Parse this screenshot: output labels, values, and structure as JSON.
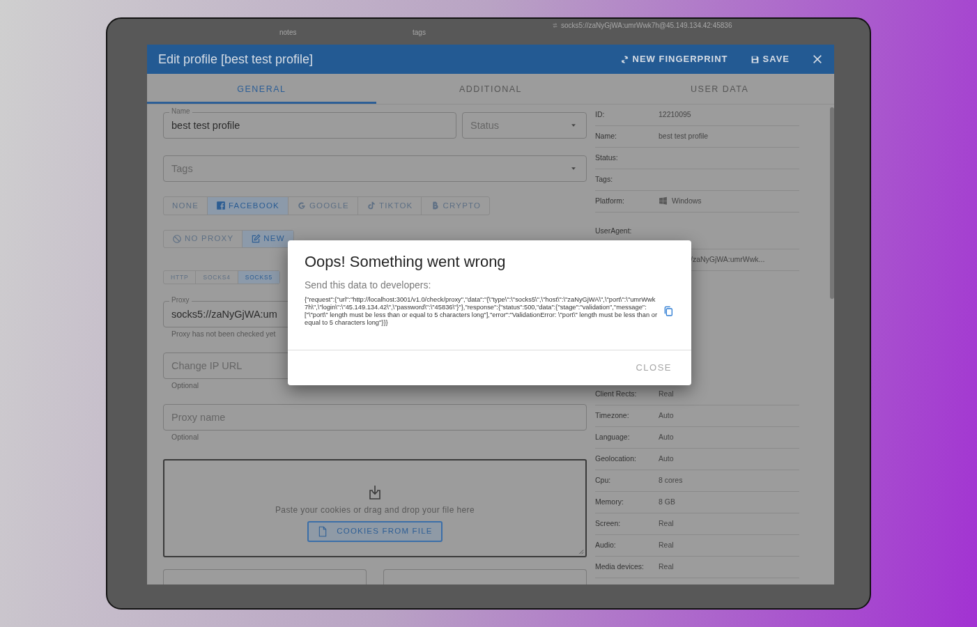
{
  "background_table": {
    "columns": [
      "notes",
      "tags"
    ],
    "proxy": "socks5://zaNyGjWA:umrWwk7h@45.149.134.42:45836"
  },
  "dialog": {
    "title": "Edit profile [best test profile]",
    "actions": [
      {
        "kind": "fingerprint",
        "label": "NEW FINGERPRINT"
      },
      {
        "kind": "save",
        "label": "SAVE"
      }
    ],
    "tabs": [
      {
        "label": "GENERAL",
        "selected": true
      },
      {
        "label": "ADDITIONAL",
        "selected": false
      },
      {
        "label": "USER DATA",
        "selected": false
      }
    ],
    "form": {
      "name_field": {
        "label": "Name",
        "value": "best test profile"
      },
      "status_field": {
        "placeholder": "Status"
      },
      "tags_field": {
        "placeholder": "Tags"
      },
      "platform_buttons": [
        {
          "kind": "none",
          "label": "NONE",
          "selected": false
        },
        {
          "kind": "facebook",
          "label": "FACEBOOK",
          "selected": true
        },
        {
          "kind": "google",
          "label": "GOOGLE",
          "selected": false
        },
        {
          "kind": "tiktok",
          "label": "TIKTOK",
          "selected": false
        },
        {
          "kind": "crypto",
          "label": "CRYPTO",
          "selected": false
        }
      ],
      "proxy_modes": [
        {
          "kind": "none",
          "label": "NO PROXY",
          "selected": false
        },
        {
          "kind": "new",
          "label": "NEW",
          "selected": true
        }
      ],
      "protocols": [
        {
          "label": "HTTP",
          "selected": false
        },
        {
          "label": "SOCKS4",
          "selected": false
        },
        {
          "label": "SOCKS5",
          "selected": true
        }
      ],
      "proxy_field": {
        "label": "Proxy",
        "value": "socks5://zaNyGjWA:um",
        "helper": "Proxy has not been checked yet"
      },
      "change_ip_field": {
        "placeholder": "Change IP URL",
        "helper": "Optional"
      },
      "proxy_name_field": {
        "placeholder": "Proxy name",
        "helper": "Optional"
      },
      "cookies": {
        "hint": "Paste your cookies or drag and drop your file here",
        "button": "COOKIES FROM FILE"
      }
    },
    "info_top": [
      {
        "label": "ID:",
        "value": "12210095"
      },
      {
        "label": "Name:",
        "value": "best test profile"
      },
      {
        "label": "Status:"
      },
      {
        "label": "Tags:"
      },
      {
        "label": "Platform:",
        "value": "Windows",
        "kind": "os"
      },
      {
        "label": "UserAgent:",
        "kind": "tall"
      },
      {
        "value": "/zaNyGjWA:umrWwk..."
      }
    ],
    "info_bottom": [
      {
        "label": "Client Rects:",
        "value": "Real"
      },
      {
        "label": "Timezone:",
        "value": "Auto"
      },
      {
        "label": "Language:",
        "value": "Auto"
      },
      {
        "label": "Geolocation:",
        "value": "Auto"
      },
      {
        "label": "Cpu:",
        "value": "8 cores"
      },
      {
        "label": "Memory:",
        "value": "8 GB"
      },
      {
        "label": "Screen:",
        "value": "Real"
      },
      {
        "label": "Audio:",
        "value": "Real"
      },
      {
        "label": "Media devices:",
        "value": "Real"
      }
    ]
  },
  "error_modal": {
    "title": "Oops! Something went wrong",
    "subtitle": "Send this data to developers:",
    "details": "{\"request\":{\"url\":\"http://localhost:3001/v1.0/check/proxy\",\"data\":\"{\\\"type\\\":\\\"socks5\\\",\\\"host\\\":\\\"zaNyGjWA\\\",\\\"port\\\":\\\"umrWwk7h\\\",\\\"login\\\":\\\"45.149.134.42\\\",\\\"password\\\":\\\"45836\\\"}\"},\"response\":{\"status\":500,\"data\":{\"stage\":\"validation\",\"message\":[\"\\\"port\\\" length must be less than or equal to 5 characters long\"],\"error\":\"ValidationError: \\\"port\\\" length must be less than or equal to 5 characters long\"}}}",
    "close": "CLOSE"
  }
}
